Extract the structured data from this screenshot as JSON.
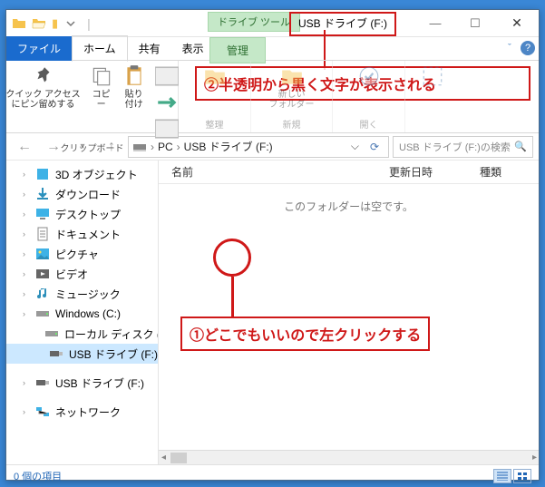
{
  "titlebar": {
    "tool_tab": "ドライブ ツール",
    "window_title": "USB ドライブ (F:)"
  },
  "tabs": {
    "file": "ファイル",
    "home": "ホーム",
    "share": "共有",
    "view": "表示",
    "manage": "管理"
  },
  "ribbon": {
    "pin": "クイック アクセス\nにピン留めする",
    "copy": "コピー",
    "paste": "貼り付け",
    "group_clipboard": "クリップボード",
    "group_organize": "整理",
    "group_new": "新規",
    "group_open": "開く",
    "new_folder": "新しい\nフォルダー"
  },
  "annotations": {
    "top": "②半透明から黒く文字が表示される",
    "bottom": "①どこでもいいので左クリックする"
  },
  "breadcrumb": {
    "pc": "PC",
    "loc": "USB ドライブ (F:)",
    "search": "USB ドライブ (F:)の検索"
  },
  "tree": {
    "items": [
      {
        "label": "3D オブジェクト",
        "icon": "3d"
      },
      {
        "label": "ダウンロード",
        "icon": "dl"
      },
      {
        "label": "デスクトップ",
        "icon": "desk"
      },
      {
        "label": "ドキュメント",
        "icon": "doc"
      },
      {
        "label": "ピクチャ",
        "icon": "pic"
      },
      {
        "label": "ビデオ",
        "icon": "vid"
      },
      {
        "label": "ミュージック",
        "icon": "mus"
      },
      {
        "label": "Windows (C:)",
        "icon": "hdd"
      },
      {
        "label": "ローカル ディスク (D",
        "icon": "hdd",
        "sub": true
      },
      {
        "label": "USB ドライブ (F:)",
        "icon": "usb",
        "sub": true,
        "selected": true
      },
      {
        "label": "USB ドライブ (F:)",
        "icon": "usb"
      },
      {
        "label": "ネットワーク",
        "icon": "net"
      }
    ]
  },
  "columns": {
    "name": "名前",
    "date": "更新日時",
    "type": "種類"
  },
  "content": {
    "empty": "このフォルダーは空です。"
  },
  "status": {
    "count": "0 個の項目"
  }
}
